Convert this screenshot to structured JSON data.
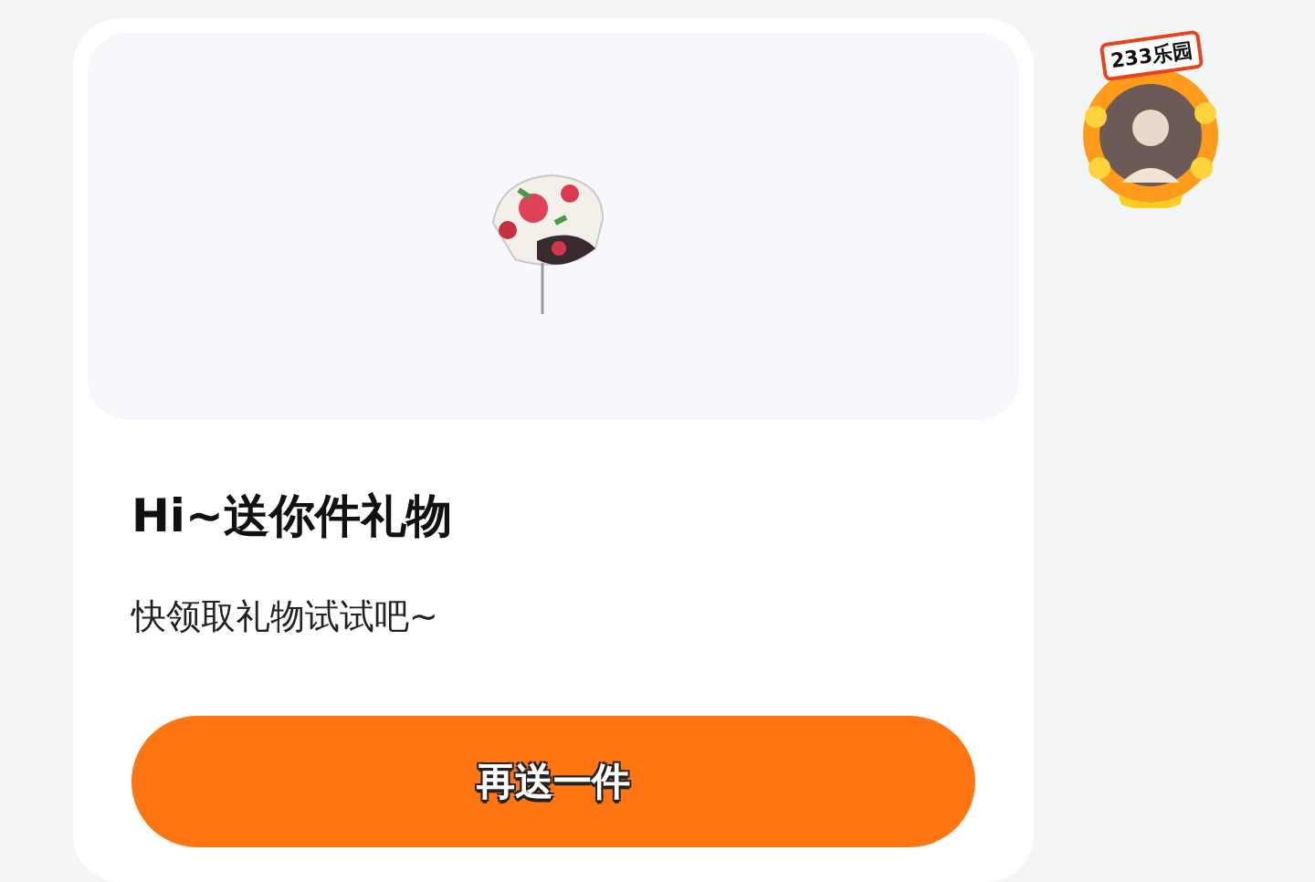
{
  "gift": {
    "title": "Hi~送你件礼物",
    "subtitle": "快领取礼物试试吧~"
  },
  "button": {
    "label": "再送一件"
  },
  "avatar_frame": {
    "badge": "233乐园"
  }
}
